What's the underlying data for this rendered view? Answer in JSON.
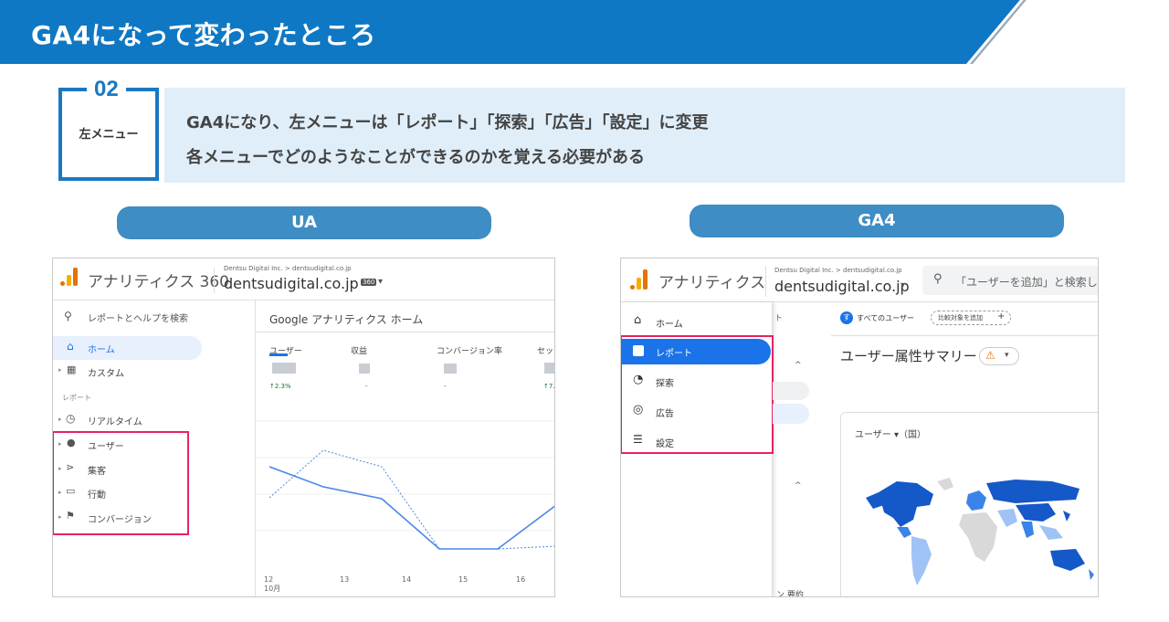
{
  "header": {
    "title": "GA4になって変わったところ"
  },
  "section": {
    "number": "02",
    "label": "左メニュー",
    "lines": [
      "GA4になり、左メニューは「レポート」「探索」「広告」「設定」に変更",
      "各メニューでどのようなことができるのかを覚える必要がある"
    ]
  },
  "ua": {
    "pill": "UA",
    "app_title": "アナリティクス 360",
    "breadcrumb": "Dentsu Digital Inc. > dentsudigital.co.jp",
    "property": "dentsudigital.co.jp",
    "property_badge": "360",
    "search": "レポートとヘルプを検索",
    "nav": {
      "home": "ホーム",
      "custom": "カスタム",
      "reports_heading": "レポート",
      "realtime": "リアルタイム",
      "user": "ユーザー",
      "acquisition": "集客",
      "behavior": "行動",
      "conversion": "コンバージョン"
    },
    "content_title": "Google アナリティクス ホーム",
    "metrics": [
      {
        "label": "ユーザー",
        "delta": "↑2.3%"
      },
      {
        "label": "収益",
        "delta": "-"
      },
      {
        "label": "コンバージョン率",
        "delta": "-"
      },
      {
        "label": "セッ",
        "delta": "↑7."
      }
    ],
    "x_ticks": [
      "12",
      "13",
      "14",
      "15",
      "16"
    ],
    "x_month": "10月",
    "colors": {
      "line": "#4a86e8",
      "accent": "#1a73e8"
    }
  },
  "ga4": {
    "pill": "GA4",
    "app_title": "アナリティクス",
    "breadcrumb": "Dentsu Digital Inc. > dentsudigital.co.jp",
    "property": "dentsudigital.co.jp",
    "search": "「ユーザーを追加」と検索して",
    "nav": {
      "home": "ホーム",
      "reports": "レポート",
      "explore": "探索",
      "ads": "広告",
      "settings": "設定"
    },
    "nav_partial": "ト",
    "chip_all_users": "すべてのユーザー",
    "chip_avatar": "す",
    "chip_compare": "比較対象を追加",
    "content_title": "ユーザー属性サマリー",
    "card_title": "ユーザー ▾（国）",
    "bottom_partial": "ン 要約"
  }
}
